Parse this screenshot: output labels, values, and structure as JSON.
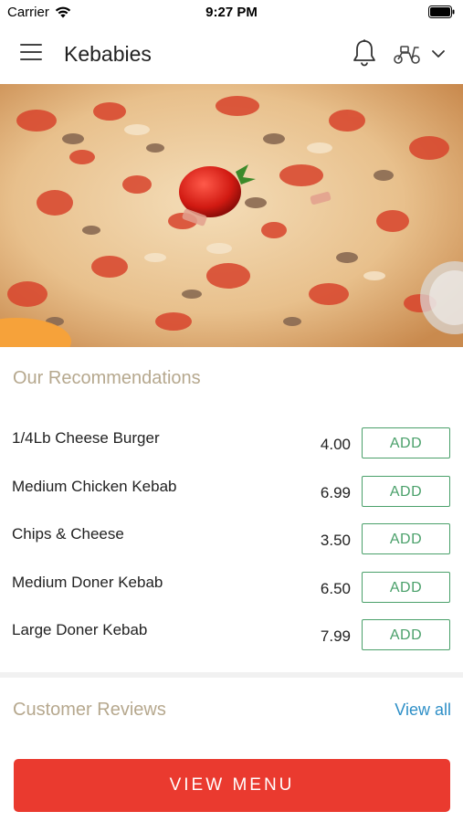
{
  "status_bar": {
    "carrier": "Carrier",
    "time": "9:27 PM"
  },
  "app_bar": {
    "title": "Kebabies"
  },
  "recommendations": {
    "title": "Our Recommendations",
    "items": [
      {
        "name": "1/4Lb Cheese Burger",
        "price": "4.00",
        "action": "ADD"
      },
      {
        "name": "Medium Chicken Kebab",
        "price": "6.99",
        "action": "ADD"
      },
      {
        "name": "Chips & Cheese",
        "price": "3.50",
        "action": "ADD"
      },
      {
        "name": "Medium Doner Kebab",
        "price": "6.50",
        "action": "ADD"
      },
      {
        "name": "Large Doner Kebab",
        "price": "7.99",
        "action": "ADD"
      }
    ]
  },
  "reviews": {
    "title": "Customer Reviews",
    "view_all": "View all"
  },
  "footer": {
    "view_menu": "VIEW MENU"
  },
  "colors": {
    "accent_red": "#ea3a2f",
    "add_green": "#4aa06a",
    "link_blue": "#2e8fc7",
    "section_title": "#b6a88e"
  },
  "icons": {
    "menu": "hamburger-menu-icon",
    "notifications": "bell-icon",
    "delivery_mode": "scooter-icon",
    "dropdown": "chevron-down-icon"
  }
}
